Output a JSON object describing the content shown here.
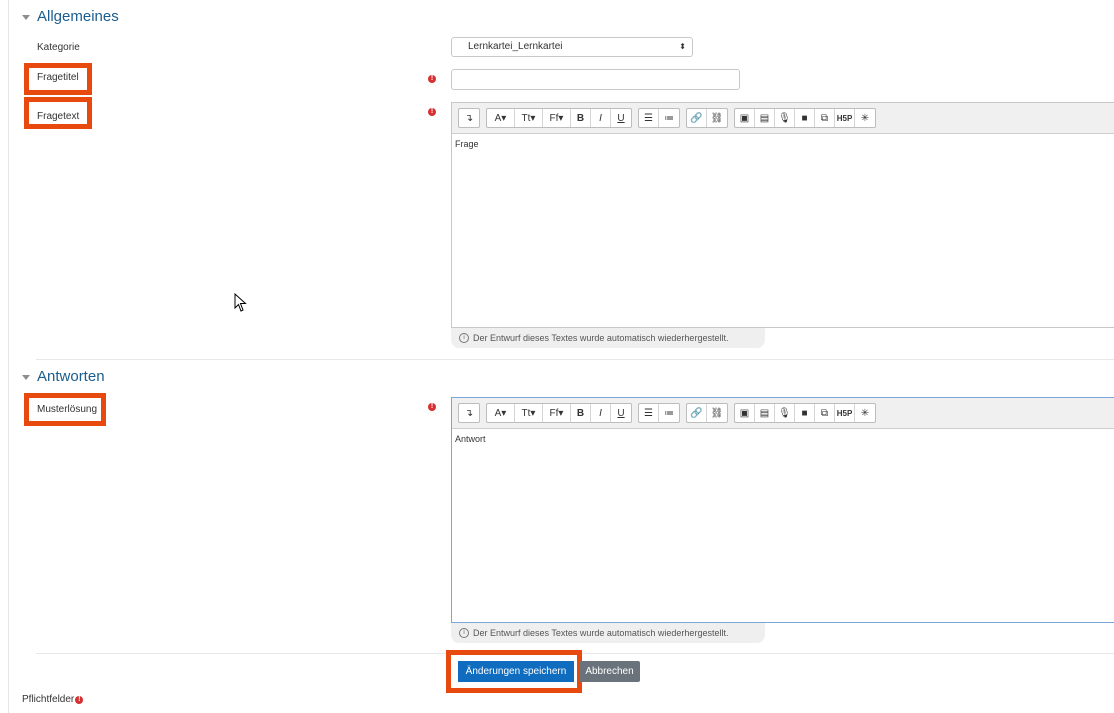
{
  "sections": {
    "general": {
      "title": "Allgemeines"
    },
    "answers": {
      "title": "Antworten"
    }
  },
  "fields": {
    "category": {
      "label": "Kategorie",
      "value": "Lernkartei_Lernkartei"
    },
    "question_title": {
      "label": "Fragetitel",
      "value": ""
    },
    "question_text": {
      "label": "Fragetext",
      "content": "Frage",
      "restore_note": "Der Entwurf dieses Textes wurde automatisch wiederhergestellt."
    },
    "model_answer": {
      "label": "Musterlösung",
      "content": "Antwort",
      "restore_note": "Der Entwurf dieses Textes wurde automatisch wiederhergestellt."
    }
  },
  "toolbar": {
    "groups": [
      [
        {
          "icon": "collapse-icon",
          "glyph": "↴"
        }
      ],
      [
        {
          "icon": "font-color-icon",
          "glyph": "A▾"
        },
        {
          "icon": "font-size-icon",
          "glyph": "Tt▾"
        },
        {
          "icon": "font-family-icon",
          "glyph": "Ff▾"
        },
        {
          "icon": "bold-icon",
          "glyph": "B"
        },
        {
          "icon": "italic-icon",
          "glyph": "I"
        },
        {
          "icon": "underline-icon",
          "glyph": "U"
        }
      ],
      [
        {
          "icon": "unordered-list-icon",
          "glyph": "☰"
        },
        {
          "icon": "ordered-list-icon",
          "glyph": "≔"
        }
      ],
      [
        {
          "icon": "link-icon",
          "glyph": "🔗"
        },
        {
          "icon": "unlink-icon",
          "glyph": "⛓"
        }
      ],
      [
        {
          "icon": "image-icon",
          "glyph": "▣"
        },
        {
          "icon": "media-icon",
          "glyph": "▤"
        },
        {
          "icon": "record-audio-icon",
          "glyph": "🎙"
        },
        {
          "icon": "record-video-icon",
          "glyph": "■"
        },
        {
          "icon": "manage-files-icon",
          "glyph": "⧉"
        },
        {
          "icon": "h5p-icon",
          "glyph": "H5P"
        },
        {
          "icon": "accessibility-checker-icon",
          "glyph": "✳"
        }
      ]
    ]
  },
  "buttons": {
    "save": "Änderungen speichern",
    "cancel": "Abbrechen"
  },
  "footer": {
    "required_label": "Pflichtfelder"
  },
  "colors": {
    "highlight": "#e8490f",
    "primary": "#0f6cbf",
    "required": "#d63031",
    "heading": "#1a5d8e"
  }
}
